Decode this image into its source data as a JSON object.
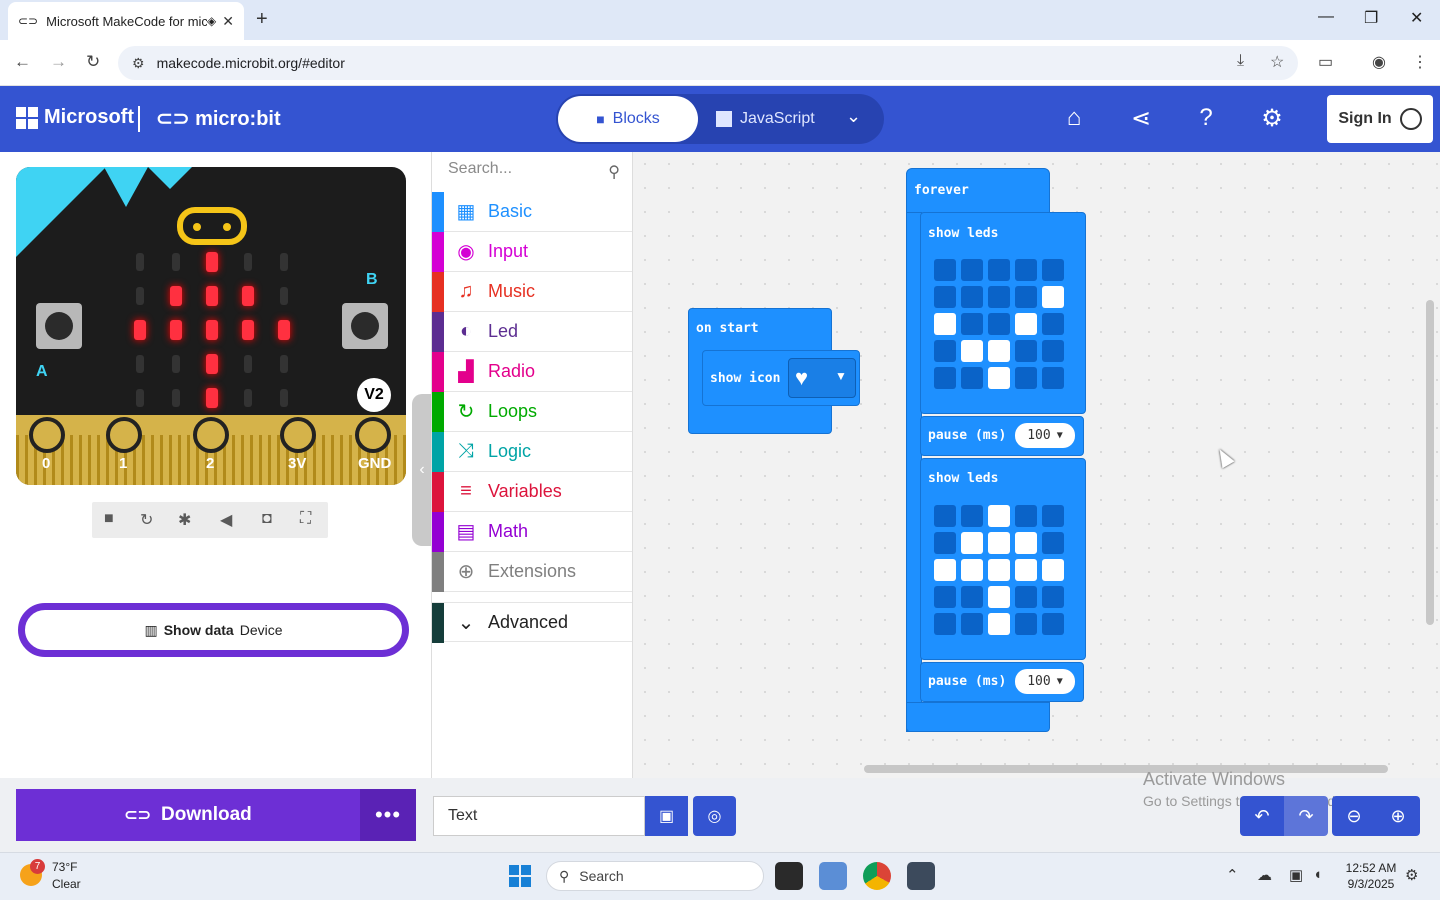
{
  "browser": {
    "tab_title": "Microsoft MakeCode for micro:bit",
    "url": "makecode.microbit.org/#editor"
  },
  "header": {
    "brand": "Microsoft",
    "product": "micro:bit",
    "mode_blocks": "Blocks",
    "mode_javascript": "JavaScript",
    "sign_in": "Sign In"
  },
  "simulator": {
    "led_matrix": [
      [
        0,
        0,
        1,
        0,
        0
      ],
      [
        0,
        1,
        1,
        1,
        0
      ],
      [
        1,
        1,
        1,
        1,
        1
      ],
      [
        0,
        0,
        1,
        0,
        0
      ],
      [
        0,
        0,
        1,
        0,
        0
      ]
    ],
    "button_a": "A",
    "button_b": "B",
    "version_badge": "V2",
    "pins": [
      "0",
      "1",
      "2",
      "3V",
      "GND"
    ],
    "show_data_label": "Show data",
    "show_data_target": "Device"
  },
  "toolbox": {
    "search_placeholder": "Search...",
    "categories": [
      {
        "label": "Basic",
        "color": "#1e90ff",
        "icon": "grid-icon"
      },
      {
        "label": "Input",
        "color": "#d400d4",
        "icon": "circle-icon"
      },
      {
        "label": "Music",
        "color": "#e63022",
        "icon": "headphones-icon"
      },
      {
        "label": "Led",
        "color": "#5c2d91",
        "icon": "toggle-icon"
      },
      {
        "label": "Radio",
        "color": "#e3008c",
        "icon": "signal-icon"
      },
      {
        "label": "Loops",
        "color": "#00aa00",
        "icon": "refresh-icon"
      },
      {
        "label": "Logic",
        "color": "#00a4a6",
        "icon": "shuffle-icon"
      },
      {
        "label": "Variables",
        "color": "#dc143c",
        "icon": "list-icon"
      },
      {
        "label": "Math",
        "color": "#9400d3",
        "icon": "calculator-icon"
      },
      {
        "label": "Extensions",
        "color": "#7f7f7f",
        "icon": "plus-circle-icon"
      }
    ],
    "advanced": "Advanced"
  },
  "workspace": {
    "on_start": {
      "label": "on start",
      "show_icon": "show icon"
    },
    "forever": {
      "label": "forever",
      "show_leds_1": {
        "label": "show leds",
        "grid": [
          [
            0,
            0,
            0,
            0,
            0
          ],
          [
            0,
            0,
            0,
            0,
            1
          ],
          [
            1,
            0,
            0,
            1,
            0
          ],
          [
            0,
            1,
            1,
            0,
            0
          ],
          [
            0,
            0,
            1,
            0,
            0
          ]
        ]
      },
      "pause_1": {
        "label": "pause (ms)",
        "value": "100"
      },
      "show_leds_2": {
        "label": "show leds",
        "grid": [
          [
            0,
            0,
            1,
            0,
            0
          ],
          [
            0,
            1,
            1,
            1,
            0
          ],
          [
            1,
            1,
            1,
            1,
            1
          ],
          [
            0,
            0,
            1,
            0,
            0
          ],
          [
            0,
            0,
            1,
            0,
            0
          ]
        ]
      },
      "pause_2": {
        "label": "pause (ms)",
        "value": "100"
      }
    }
  },
  "bottom": {
    "download": "Download",
    "project_name": "Text"
  },
  "watermark": {
    "line1": "Activate Windows",
    "line2": "Go to Settings to activate Windows."
  },
  "taskbar": {
    "weather_temp": "73°F",
    "weather_cond": "Clear",
    "weather_badge": "7",
    "search": "Search",
    "time": "12:52 AM",
    "date": "9/3/2025"
  }
}
